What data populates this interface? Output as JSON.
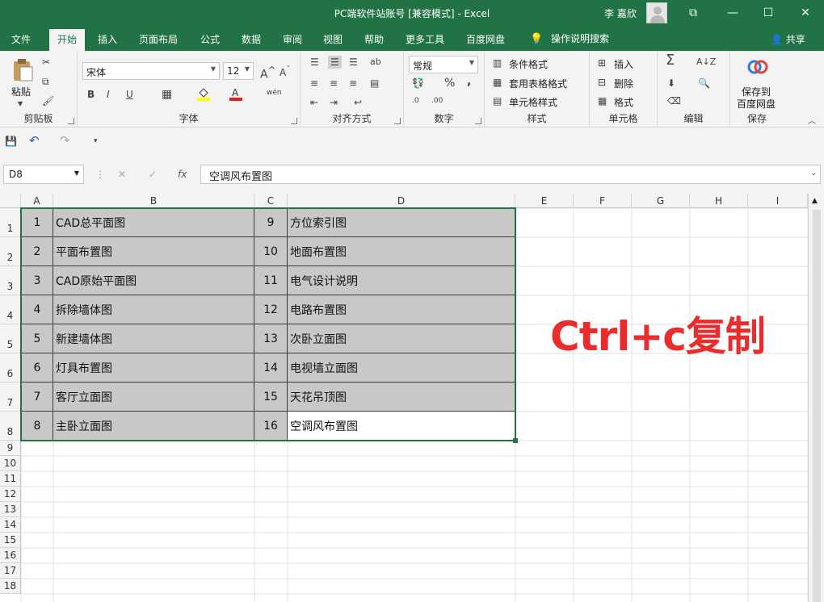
{
  "window": {
    "title": "PC端软件站账号  [兼容模式]  -  Excel",
    "user": "李 嘉欣",
    "controls": {
      "ribbon_display": "⧉",
      "minimize": "—",
      "maximize": "☐",
      "close": "✕"
    }
  },
  "menu": {
    "tabs": [
      "文件",
      "开始",
      "插入",
      "页面布局",
      "公式",
      "数据",
      "审阅",
      "视图",
      "帮助",
      "更多工具",
      "百度网盘"
    ],
    "active": "开始",
    "tell_me": "操作说明搜索",
    "share": "共享"
  },
  "ribbon": {
    "clipboard": {
      "label": "剪贴板",
      "paste": "粘贴"
    },
    "font": {
      "label": "字体",
      "name": "宋体",
      "size": "12",
      "bold": "B",
      "italic": "I",
      "underline": "U",
      "phonetic": "wén"
    },
    "alignment": {
      "label": "对齐方式"
    },
    "number": {
      "label": "数字",
      "format": "常规",
      "percent": "%",
      "comma": ","
    },
    "styles": {
      "label": "样式",
      "conditional": "条件格式",
      "table": "套用表格格式",
      "cell_styles": "单元格样式"
    },
    "cells": {
      "label": "单元格",
      "insert": "插入",
      "delete": "删除",
      "format": "格式"
    },
    "editing": {
      "label": "编辑"
    },
    "save": {
      "label": "保存",
      "button_line1": "保存到",
      "button_line2": "百度网盘"
    }
  },
  "formula_bar": {
    "name_box": "D8",
    "cancel": "✕",
    "enter": "✓",
    "fx": "fx",
    "content": "空调风布置图"
  },
  "sheet": {
    "columns": [
      "A",
      "B",
      "C",
      "D",
      "E",
      "F",
      "G",
      "H",
      "I"
    ],
    "rows": [
      "1",
      "2",
      "3",
      "4",
      "5",
      "6",
      "7",
      "8",
      "9",
      "10",
      "11",
      "12",
      "13",
      "14",
      "15",
      "16",
      "17",
      "18"
    ],
    "table": [
      [
        "1",
        "CAD总平面图",
        "9",
        "方位索引图"
      ],
      [
        "2",
        "平面布置图",
        "10",
        "地面布置图"
      ],
      [
        "3",
        "CAD原始平面图",
        "11",
        "电气设计说明"
      ],
      [
        "4",
        "拆除墙体图",
        "12",
        "电路布置图"
      ],
      [
        "5",
        "新建墙体图",
        "13",
        "次卧立面图"
      ],
      [
        "6",
        "灯具布置图",
        "14",
        "电视墙立面图"
      ],
      [
        "7",
        "客厅立面图",
        "15",
        "天花吊顶图"
      ],
      [
        "8",
        "主卧立面图",
        "16",
        "空调风布置图"
      ]
    ],
    "selected_fill": "#c8c8c8",
    "annotation": "Ctrl+c复制",
    "annotation_color": "#ea2c2c"
  },
  "colors": {
    "excel_green": "#217346"
  }
}
